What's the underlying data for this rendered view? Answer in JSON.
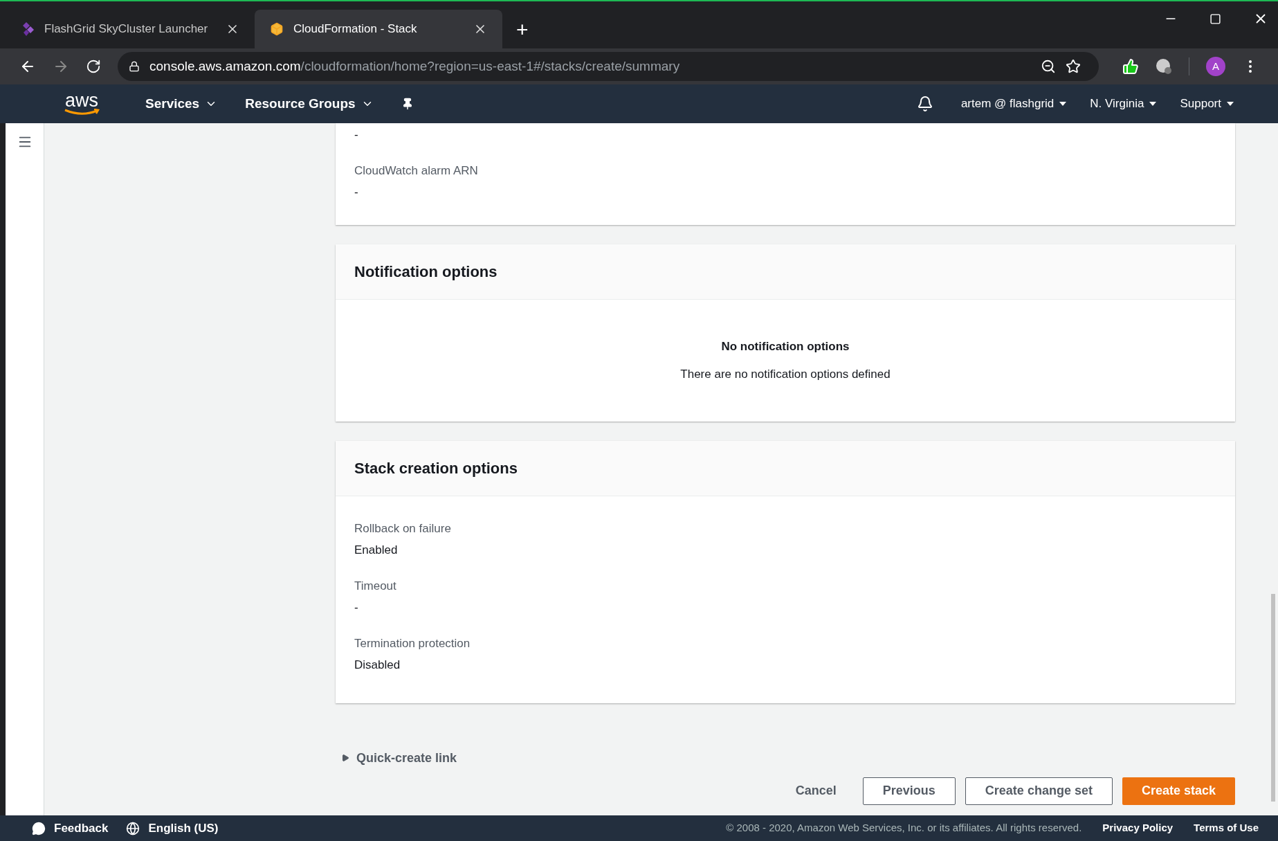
{
  "browser": {
    "tabs": [
      {
        "title": "FlashGrid SkyCluster Launcher",
        "selected": false
      },
      {
        "title": "CloudFormation - Stack",
        "selected": true
      }
    ],
    "new_tab": "+",
    "url_host": "console.aws.amazon.com",
    "url_path": "/cloudformation/home?region=us-east-1#/stacks/create/summary",
    "profile_initial": "A"
  },
  "nav": {
    "logo": "aws",
    "menus": [
      "Services",
      "Resource Groups"
    ],
    "account": "artem @ flashgrid",
    "region": "N. Virginia",
    "support": "Support"
  },
  "top_card": {
    "fields": [
      {
        "value": "-"
      },
      {
        "label": "CloudWatch alarm ARN",
        "value": "-"
      }
    ]
  },
  "notification_card": {
    "title": "Notification options",
    "empty_title": "No notification options",
    "empty_text": "There are no notification options defined"
  },
  "stack_card": {
    "title": "Stack creation options",
    "fields": [
      {
        "label": "Rollback on failure",
        "value": "Enabled"
      },
      {
        "label": "Timeout",
        "value": "-"
      },
      {
        "label": "Termination protection",
        "value": "Disabled"
      }
    ]
  },
  "quick_create": {
    "label": "Quick-create link",
    "expanded": false
  },
  "buttons": [
    {
      "label": "Cancel",
      "kind": "link"
    },
    {
      "label": "Previous",
      "kind": "outline"
    },
    {
      "label": "Create change set",
      "kind": "outline"
    },
    {
      "label": "Create stack",
      "kind": "primary"
    }
  ],
  "footer": {
    "feedback": "Feedback",
    "language": "English (US)",
    "copyright": "© 2008 - 2020, Amazon Web Services, Inc. or its affiliates. All rights reserved.",
    "links": [
      "Privacy Policy",
      "Terms of Use"
    ]
  }
}
